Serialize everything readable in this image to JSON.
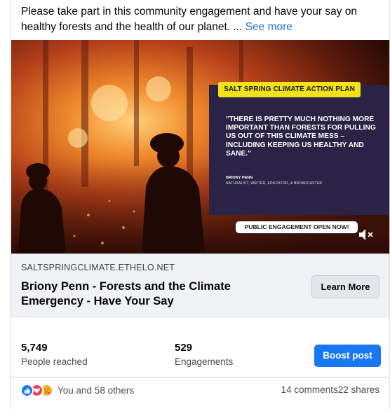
{
  "post": {
    "text": "Please take part in this community engagement and have your say on healthy forests and the health of our planet. ...",
    "see_more": "See more"
  },
  "media": {
    "plan_label": "SALT SPRING CLIMATE ACTION PLAN",
    "quote": "\"THERE IS PRETTY MUCH NOTHING MORE IMPORTANT THAN FORESTS FOR PULLING US OUT OF THIS CLIMATE MESS – INCLUDING KEEPING US HEALTHY AND SANE.\"",
    "author": "BRIONY PENN",
    "author_role": "NATURALIST, WRITER, EDUCATOR, & BROADCASTER",
    "engagement_label": "PUBLIC ENGAGEMENT OPEN NOW!",
    "mute_icon": "speaker-muted-icon"
  },
  "link": {
    "domain": "SALTSPRINGCLIMATE.ETHELO.NET",
    "title": "Briony Penn - Forests and the Climate Emergency - Have Your Say",
    "button": "Learn More"
  },
  "stats": {
    "reached_value": "5,749",
    "reached_label": "People reached",
    "engagements_value": "529",
    "engagements_label": "Engagements",
    "boost_label": "Boost post"
  },
  "footer": {
    "reactions_text": "You and 58 others",
    "comments": "14 comments",
    "shares": "22 shares",
    "reaction_icons": [
      "like-icon",
      "love-icon",
      "care-icon"
    ]
  },
  "colors": {
    "accent": "#1877f2",
    "link": "#216fdb",
    "plan_label_bg": "#f1e21c",
    "quote_box_bg": "#2a2345"
  }
}
